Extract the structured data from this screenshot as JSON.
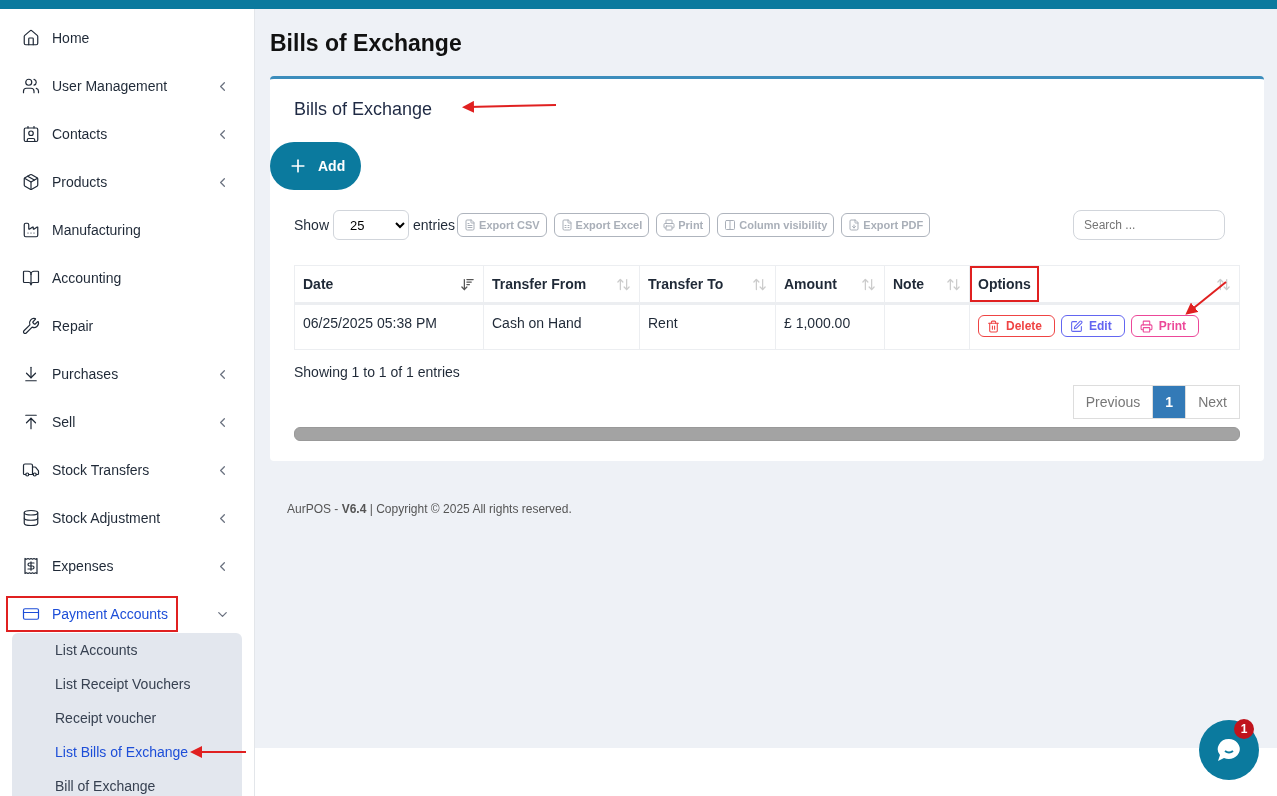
{
  "sidebar": {
    "items": [
      {
        "label": "Home",
        "kind": "link",
        "selected": false
      },
      {
        "label": "User Management",
        "kind": "group",
        "expanded": false,
        "selected": false
      },
      {
        "label": "Contacts",
        "kind": "group",
        "expanded": false,
        "selected": false
      },
      {
        "label": "Products",
        "kind": "group",
        "expanded": false,
        "selected": false
      },
      {
        "label": "Manufacturing",
        "kind": "link",
        "selected": false
      },
      {
        "label": "Accounting",
        "kind": "link",
        "selected": false
      },
      {
        "label": "Repair",
        "kind": "link",
        "selected": false
      },
      {
        "label": "Purchases",
        "kind": "group",
        "expanded": false,
        "selected": false
      },
      {
        "label": "Sell",
        "kind": "group",
        "expanded": false,
        "selected": false
      },
      {
        "label": "Stock Transfers",
        "kind": "group",
        "expanded": false,
        "selected": false
      },
      {
        "label": "Stock Adjustment",
        "kind": "group",
        "expanded": false,
        "selected": false
      },
      {
        "label": "Expenses",
        "kind": "group",
        "expanded": false,
        "selected": false
      },
      {
        "label": "Payment Accounts",
        "kind": "group",
        "expanded": true,
        "selected": true,
        "highlighted": true,
        "children": [
          {
            "label": "List Accounts",
            "selected": false
          },
          {
            "label": "List Receipt Vouchers",
            "selected": false
          },
          {
            "label": "Receipt voucher",
            "selected": false
          },
          {
            "label": "List Bills of Exchange",
            "selected": true
          },
          {
            "label": "Bill of Exchange",
            "selected": false
          }
        ]
      }
    ]
  },
  "page_title": "Bills of Exchange",
  "card": {
    "title": "Bills of Exchange",
    "add_button": "Add",
    "length": {
      "label_before": "Show",
      "value": "25",
      "label_after": "entries"
    },
    "export_buttons": [
      {
        "label": "Export CSV",
        "kind": "csv",
        "disabled": true
      },
      {
        "label": "Export Excel",
        "kind": "excel",
        "disabled": true
      },
      {
        "label": "Print",
        "kind": "print",
        "disabled": true
      },
      {
        "label": "Column visibility",
        "kind": "columns",
        "disabled": true
      },
      {
        "label": "Export PDF",
        "kind": "pdf",
        "disabled": true
      }
    ],
    "search": {
      "placeholder": "Search ..."
    },
    "table": {
      "columns": [
        {
          "label": "Date",
          "sorted": true,
          "highlighted": false
        },
        {
          "label": "Transfer From",
          "sorted": false,
          "highlighted": false
        },
        {
          "label": "Transfer To",
          "sorted": false,
          "highlighted": false
        },
        {
          "label": "Amount",
          "sorted": false,
          "highlighted": false
        },
        {
          "label": "Note",
          "sorted": false,
          "highlighted": false
        },
        {
          "label": "Options",
          "sorted": false,
          "highlighted": true
        }
      ],
      "rows": [
        {
          "date": "06/25/2025 05:38 PM",
          "transfer_from": "Cash on Hand",
          "transfer_to": "Rent",
          "amount": "£ 1,000.00",
          "actions": [
            {
              "label": "Delete",
              "kind": "delete"
            },
            {
              "label": "Edit",
              "kind": "edit"
            },
            {
              "label": "Print",
              "kind": "print"
            }
          ]
        }
      ]
    },
    "info": "Showing 1 to 1 of 1 entries",
    "pagination": [
      {
        "label": "Previous",
        "selected": false
      },
      {
        "label": "1",
        "selected": true
      },
      {
        "label": "Next",
        "selected": false
      }
    ]
  },
  "footer": "AurPOS - **V6.4** | Copyright © 2025 All rights reserved.",
  "chat": {
    "badge": "1"
  }
}
